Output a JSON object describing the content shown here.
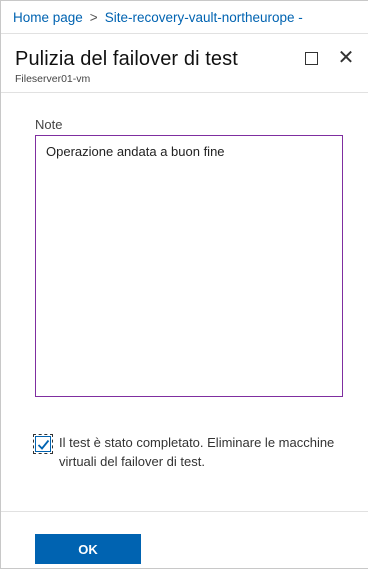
{
  "breadcrumb": {
    "items": [
      "Home page",
      "Site-recovery-vault-northeurope -"
    ],
    "separator": ">"
  },
  "header": {
    "title": "Pulizia del failover di test",
    "subtitle": "Fileserver01-vm"
  },
  "icons": {
    "maximize": "maximize-icon",
    "close": "close-icon",
    "check": "checkmark-icon"
  },
  "form": {
    "note_label": "Note",
    "note_value": "Operazione andata a buon fine",
    "checkbox_label": "Il test è stato completato. Eliminare le macchine virtuali del failover di test.",
    "checkbox_checked": true
  },
  "footer": {
    "ok_label": "OK"
  },
  "colors": {
    "accent": "#0063b1",
    "note_border": "#7f2ea0"
  }
}
